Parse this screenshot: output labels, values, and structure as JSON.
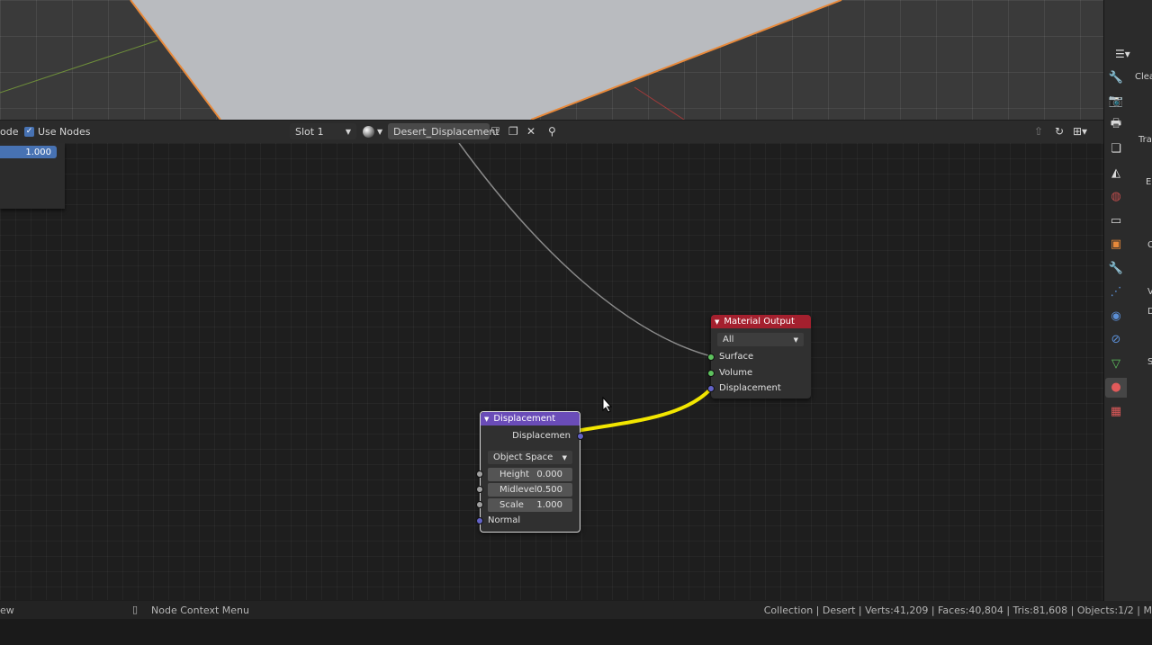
{
  "header": {
    "left_cut_text": "ode",
    "use_nodes_label": "Use Nodes",
    "slot_label": "Slot 1",
    "material_name": "Desert_Displacement"
  },
  "left_panel": {
    "value": "1.000"
  },
  "nodes": {
    "material_output": {
      "title": "Material Output",
      "target": "All",
      "inputs": [
        "Surface",
        "Volume",
        "Displacement"
      ]
    },
    "displacement": {
      "title": "Displacement",
      "output": "Displacemen",
      "space": "Object Space",
      "fields": [
        {
          "label": "Height",
          "value": "0.000"
        },
        {
          "label": "Midlevel",
          "value": "0.500"
        },
        {
          "label": "Scale",
          "value": "1.000"
        }
      ],
      "normal_label": "Normal"
    }
  },
  "status_bar": {
    "left_cut_text": "ew",
    "context_menu": "Node Context Menu",
    "stats": "Collection | Desert | Verts:41,209 | Faces:40,804 | Tris:81,608 | Objects:1/2 | M"
  },
  "properties_cut": {
    "t1": "Clea",
    "t2": "Tra",
    "t3": "E",
    "t4": "C",
    "t5": "V",
    "t6": "D",
    "t7": "S"
  },
  "colors": {
    "material_output_header": "#a4202e",
    "displacement_header": "#6a4cb8",
    "link_highlight": "#f2e600",
    "accent_blue": "#4772b3"
  },
  "icons": [
    "shader-type-icon",
    "checkbox-icon",
    "material-icon",
    "fake-user-shield-icon",
    "duplicate-icon",
    "unlink-x-icon",
    "pin-icon",
    "parent-up-icon",
    "backdrop-icon",
    "snapping-icon",
    "cursor-arrow-icon"
  ]
}
